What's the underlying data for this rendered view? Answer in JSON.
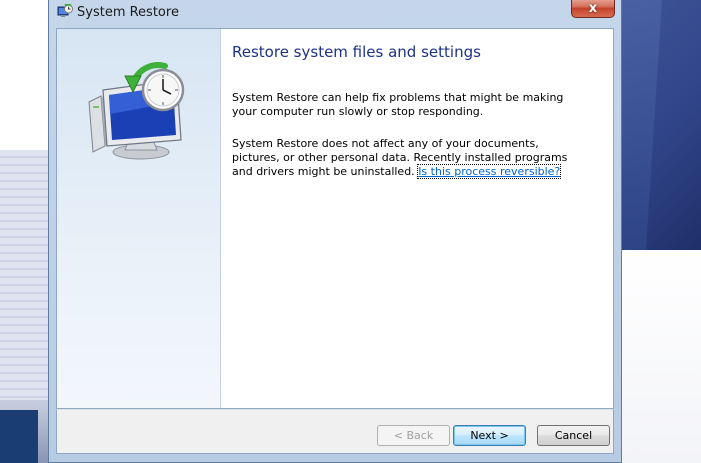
{
  "window": {
    "title": "System Restore",
    "close_label": "x"
  },
  "main": {
    "heading": "Restore system files and settings",
    "paragraph1": "System Restore can help fix problems that might be making your computer run slowly or stop responding.",
    "paragraph2": "System Restore does not affect any of your documents, pictures, or other personal data. Recently installed programs and drivers might be uninstalled.",
    "link_text": "Is this process reversible?"
  },
  "footer": {
    "back_label": "< Back",
    "next_label": "Next >",
    "cancel_label": "Cancel"
  },
  "colors": {
    "heading": "#1e3287",
    "link": "#0066cc",
    "close_button": "#c4412b"
  },
  "icons": {
    "title": "system-restore-icon",
    "main": "computer-clock-restore-icon"
  }
}
